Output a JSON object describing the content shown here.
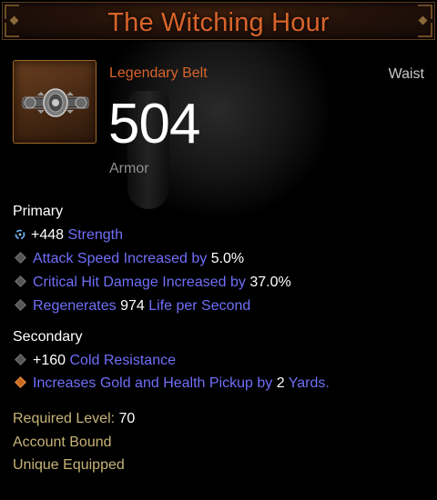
{
  "item": {
    "name": "The Witching Hour",
    "type": "Legendary Belt",
    "slot": "Waist",
    "armor_value": "504",
    "armor_label": "Armor"
  },
  "primary": {
    "label": "Primary",
    "stats": [
      {
        "prefix": "+448",
        "text": "Strength",
        "bullet": "swirl-icon"
      },
      {
        "text": "Attack Speed Increased by",
        "value": "5.0%",
        "bullet": "gray-diamond-icon"
      },
      {
        "text": "Critical Hit Damage Increased by",
        "value": "37.0%",
        "bullet": "gray-diamond-icon"
      },
      {
        "text": "Regenerates",
        "value": "974",
        "suffix": "Life per Second",
        "bullet": "gray-diamond-icon"
      }
    ]
  },
  "secondary": {
    "label": "Secondary",
    "stats": [
      {
        "prefix": "+160",
        "text": "Cold Resistance",
        "bullet": "gray-diamond-icon"
      },
      {
        "text": "Increases Gold and Health Pickup by",
        "value": "2",
        "suffix": "Yards.",
        "bullet": "orange-diamond-icon"
      }
    ]
  },
  "requirements": {
    "level_label": "Required Level:",
    "level_value": "70",
    "binding": "Account Bound",
    "unique": "Unique Equipped"
  },
  "colors": {
    "title": "#d8642a",
    "affix_blue": "#6f6ff8",
    "requirement_gold": "#c7b377",
    "armor_label_gray": "#909090"
  }
}
